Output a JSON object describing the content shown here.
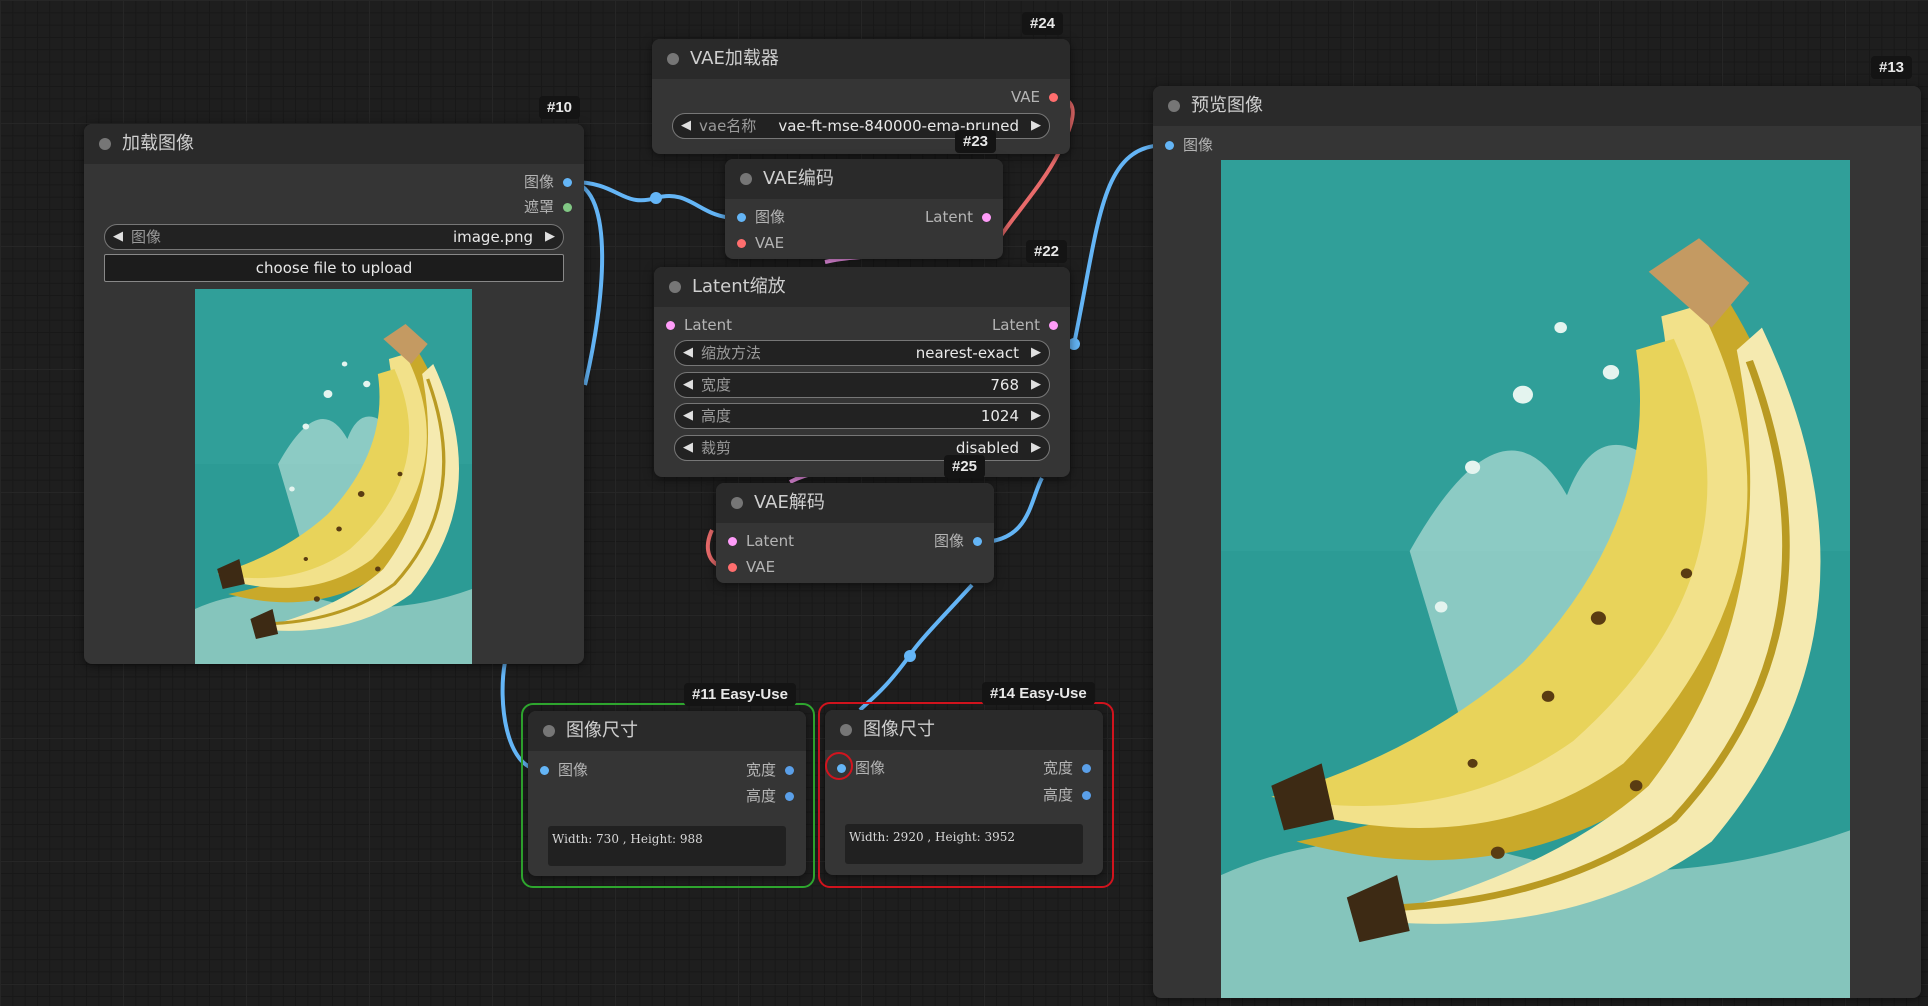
{
  "colors": {
    "image": "#64b5f6",
    "mask": "#81c784",
    "latent": "#ff9cf9",
    "vae": "#ff6e6e",
    "success_outline": "#2fa82f",
    "error_outline": "#d2141e"
  },
  "nodes": {
    "load_image": {
      "badge": "#10",
      "title": "加载图像",
      "out_image": "图像",
      "out_mask": "遮罩",
      "image_widget": {
        "label": "图像",
        "value": "image.png"
      },
      "upload_button": "choose file to upload",
      "preview": "banana-splash-thumbnail"
    },
    "vae_loader": {
      "badge": "#24",
      "title": "VAE加载器",
      "out_vae": "VAE",
      "vae_widget": {
        "label": "vae名称",
        "value": "vae-ft-mse-840000-ema-pruned"
      }
    },
    "vae_encode": {
      "badge": "#23",
      "title": "VAE编码",
      "in_image": "图像",
      "in_vae": "VAE",
      "out_latent": "Latent"
    },
    "latent_upscale": {
      "badge": "#22",
      "title": "Latent缩放",
      "in_latent": "Latent",
      "out_latent": "Latent",
      "method": {
        "label": "缩放方法",
        "value": "nearest-exact"
      },
      "width": {
        "label": "宽度",
        "value": "768"
      },
      "height": {
        "label": "高度",
        "value": "1024"
      },
      "crop": {
        "label": "裁剪",
        "value": "disabled"
      }
    },
    "vae_decode": {
      "badge": "#25",
      "title": "VAE解码",
      "in_latent": "Latent",
      "in_vae": "VAE",
      "out_image": "图像"
    },
    "image_size_11": {
      "badge": "#11 Easy-Use",
      "title": "图像尺寸",
      "in_image": "图像",
      "out_width": "宽度",
      "out_height": "高度",
      "info": "Width: 730 , Height: 988"
    },
    "image_size_14": {
      "badge": "#14 Easy-Use",
      "title": "图像尺寸",
      "in_image": "图像",
      "out_width": "宽度",
      "out_height": "高度",
      "info": "Width: 2920 , Height: 3952"
    },
    "preview_image": {
      "badge": "#13",
      "title": "预览图像",
      "in_image": "图像",
      "preview": "banana-splash-preview"
    }
  }
}
